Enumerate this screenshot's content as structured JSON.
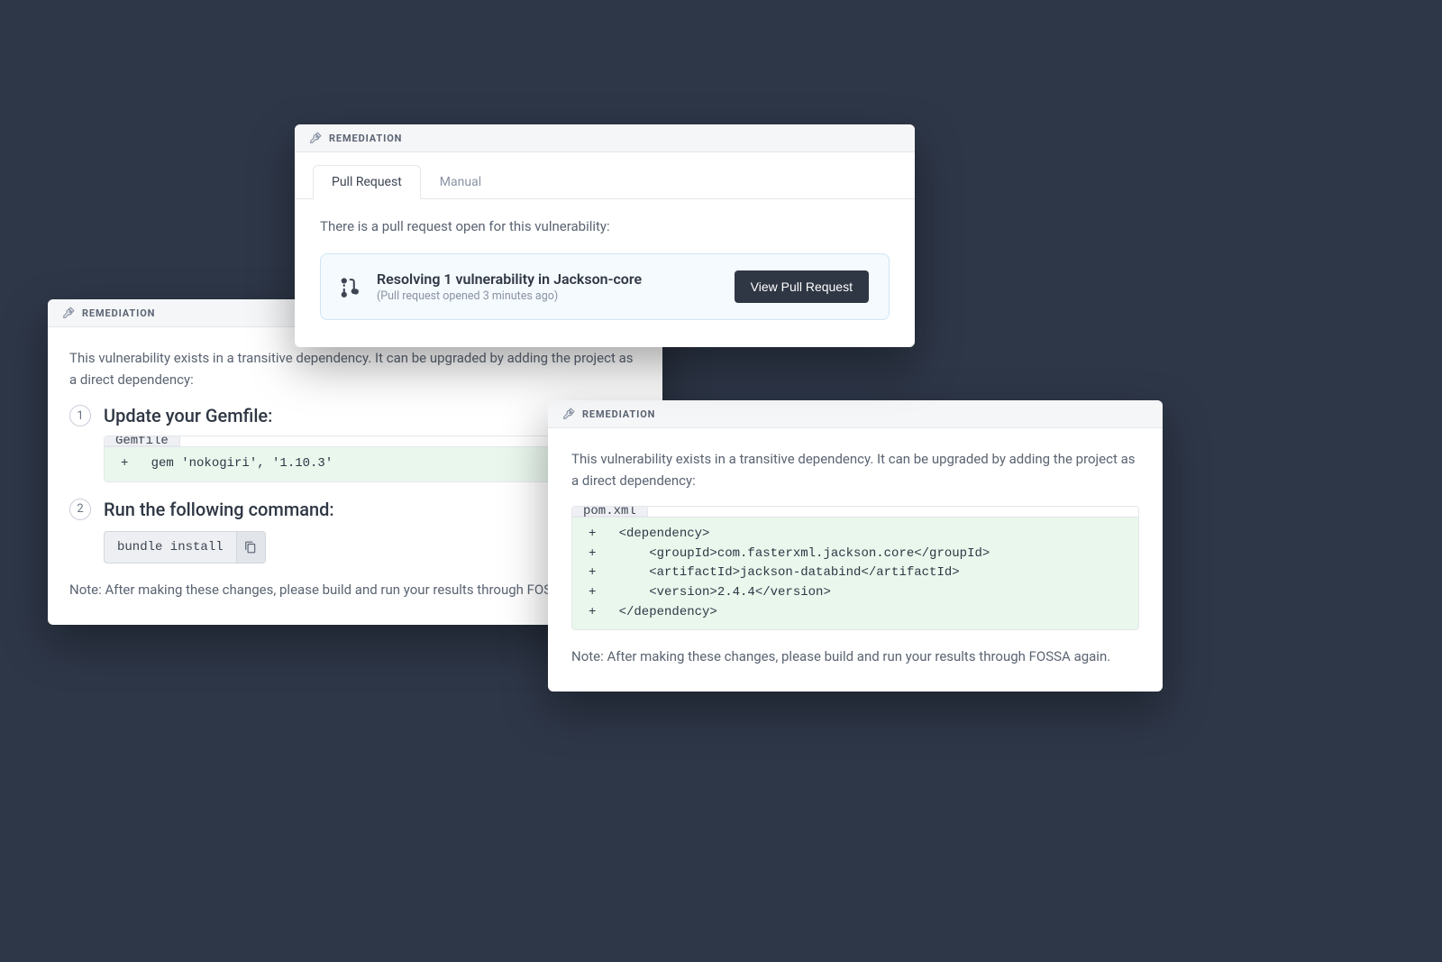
{
  "header_label": "REMEDIATION",
  "top_card": {
    "tabs": {
      "pr": "Pull Request",
      "manual": "Manual"
    },
    "desc": "There is a pull request open for this vulnerability:",
    "pr_title": "Resolving 1 vulnerability in Jackson-core",
    "pr_sub": "(Pull request opened 3 minutes ago)",
    "view_btn": "View Pull Request"
  },
  "left_card": {
    "desc": "This vulnerability exists in a transitive dependency. It can be upgraded by adding the project as a direct dependency:",
    "step1_title": "Update your Gemfile:",
    "step1_file": "Gemfile",
    "step1_code": "+   gem 'nokogiri', '1.10.3'",
    "step2_title": "Run the following command:",
    "step2_cmd": "bundle install",
    "note": "Note: After making these changes, please build and run your results through FOSSA again."
  },
  "right_card": {
    "desc": "This vulnerability exists in a transitive dependency. It can be upgraded by adding the project as a direct dependency:",
    "file": "pom.xml",
    "code": "+   <dependency>\n+       <groupId>com.fasterxml.jackson.core</groupId>\n+       <artifactId>jackson-databind</artifactId>\n+       <version>2.4.4</version>\n+   </dependency>",
    "note": "Note: After making these changes, please build and run your results through FOSSA again."
  }
}
